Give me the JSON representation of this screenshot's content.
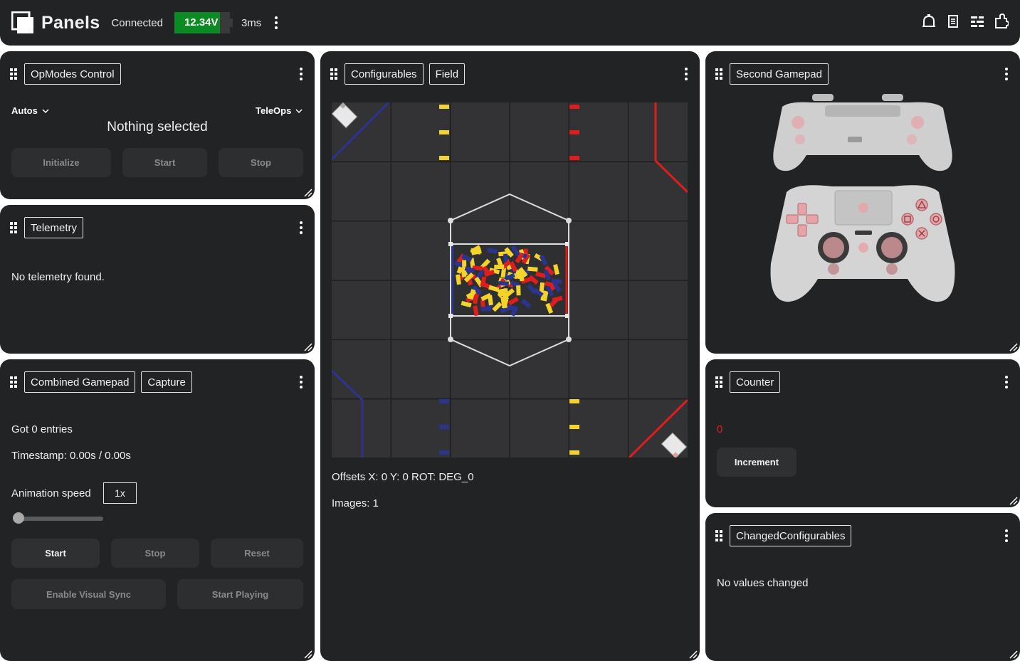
{
  "app": {
    "title": "Panels",
    "status": "Connected",
    "battery": {
      "voltage": "12.34V",
      "level": 0.82,
      "color": "#0c8a23"
    },
    "ping": "3ms",
    "icons": [
      "bell-icon",
      "document-icon",
      "list-icon",
      "puzzle-icon"
    ]
  },
  "opmodes": {
    "tab": "OpModes Control",
    "autos_label": "Autos",
    "teleops_label": "TeleOps",
    "status": "Nothing selected",
    "buttons": {
      "init": "Initialize",
      "start": "Start",
      "stop": "Stop"
    }
  },
  "telemetry": {
    "tab": "Telemetry",
    "message": "No telemetry found."
  },
  "combined": {
    "tabs": [
      "Combined Gamepad",
      "Capture"
    ],
    "entries": "Got 0 entries",
    "timestamp": "Timestamp: 0.00s / 0.00s",
    "speed_label": "Animation speed",
    "speed_value": "1x",
    "buttons": {
      "start": "Start",
      "stop": "Stop",
      "reset": "Reset",
      "sync": "Enable Visual Sync",
      "play": "Start Playing"
    }
  },
  "config": {
    "tabs": [
      "Configurables",
      "Field"
    ],
    "offsets": "Offsets X: 0 Y: 0 ROT: DEG_0",
    "images": "Images: 1"
  },
  "gamepad2": {
    "tab": "Second Gamepad"
  },
  "counter": {
    "tab": "Counter",
    "value": "0",
    "value_color": "#e0231c",
    "button": "Increment"
  },
  "changed": {
    "tab": "ChangedConfigurables",
    "message": "No values changed"
  },
  "colors": {
    "panel": "#222324",
    "field": "#333335",
    "red": "#e01d1d",
    "blue": "#2b3590",
    "yellow": "#f4d32b"
  }
}
